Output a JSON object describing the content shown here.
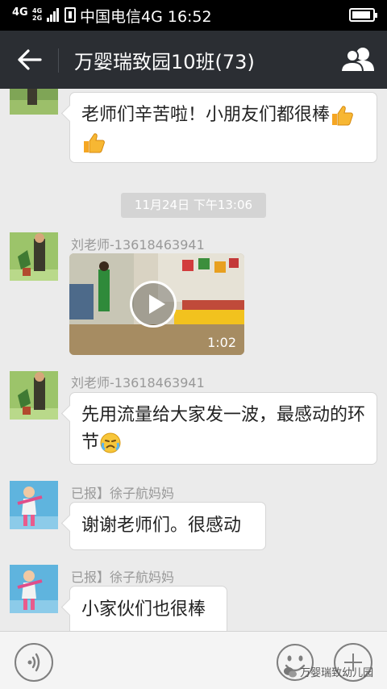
{
  "status_bar": {
    "network": "4G",
    "network_small_top": "4G",
    "network_small_bottom": "2G",
    "carrier_time": "中国电信4G 16:52"
  },
  "header": {
    "title": "万婴瑞致园10班(73)"
  },
  "chat": {
    "timestamp": "11月24日 下午13:06",
    "messages": [
      {
        "text": "老师们辛苦啦！小朋友们都很棒",
        "emoji": "thumbs-up x2"
      },
      {
        "sender": "刘老师-13618463941",
        "type": "video",
        "duration": "1:02"
      },
      {
        "sender": "刘老师-13618463941",
        "text": "先用流量给大家发一波，最感动的环节",
        "emoji": "crying-face"
      },
      {
        "sender": "已报】徐子航妈妈",
        "text": "谢谢老师们。很感动"
      },
      {
        "sender": "已报】徐子航妈妈",
        "text": "小家伙们也很棒"
      }
    ]
  },
  "input_bar": {
    "watermark": "万婴瑞致幼儿园"
  },
  "colors": {
    "title_bar": "#2b2e33",
    "chat_background": "#ebebeb",
    "bubble": "#ffffff",
    "thumbs_up": "#f5a623"
  },
  "icons": [
    "back-arrow-icon",
    "group-members-icon",
    "voice-icon",
    "emoji-icon",
    "plus-icon",
    "play-icon",
    "thumbs-up-icon",
    "crying-face-icon",
    "wechat-icon"
  ]
}
